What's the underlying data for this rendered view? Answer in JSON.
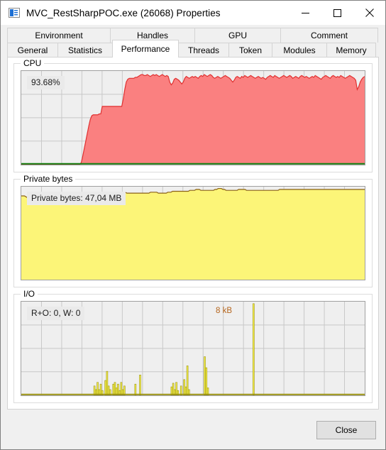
{
  "window": {
    "title": "MVC_RestSharpPOC.exe (26068) Properties",
    "icon": "properties-window-icon",
    "controls": {
      "minimize": "minimize-icon",
      "maximize": "maximize-icon",
      "close": "close-icon"
    }
  },
  "tabs": {
    "row1": [
      {
        "label": "Environment",
        "id": "environment",
        "selected": false
      },
      {
        "label": "Handles",
        "id": "handles",
        "selected": false
      },
      {
        "label": "GPU",
        "id": "gpu",
        "selected": false
      },
      {
        "label": "Comment",
        "id": "comment",
        "selected": false
      }
    ],
    "row2": [
      {
        "label": "General",
        "id": "general",
        "selected": false
      },
      {
        "label": "Statistics",
        "id": "statistics",
        "selected": false
      },
      {
        "label": "Performance",
        "id": "performance",
        "selected": true
      },
      {
        "label": "Threads",
        "id": "threads",
        "selected": false
      },
      {
        "label": "Token",
        "id": "token",
        "selected": false
      },
      {
        "label": "Modules",
        "id": "modules",
        "selected": false
      },
      {
        "label": "Memory",
        "id": "memory",
        "selected": false
      }
    ]
  },
  "panels": {
    "cpu": {
      "group_label": "CPU",
      "value_label": "93.68%"
    },
    "private_bytes": {
      "group_label": "Private bytes",
      "value_label": "Private bytes: 47,04 MB"
    },
    "io": {
      "group_label": "I/O",
      "value_label": "R+O: 0, W: 0",
      "peak_label": "8 kB"
    }
  },
  "footer": {
    "close_label": "Close"
  },
  "colors": {
    "cpu_fill": "#fa8080",
    "cpu_stroke": "#e03030",
    "cpu_baseline": "#128012",
    "private_fill": "#fcf578",
    "private_stroke": "#8a6118",
    "io_fill": "#f5ef4a",
    "io_stroke": "#9a9212",
    "io_peak_text": "#b5651d",
    "graph_bg": "#efefef",
    "grid": "#c8c8c8",
    "window_bg": "#f0f0f0"
  },
  "chart_data": [
    {
      "type": "area",
      "name": "cpu",
      "title": "CPU",
      "ylabel": "%",
      "ylim": [
        0,
        100
      ],
      "grid": true,
      "value_label": "93.68%",
      "current_value": 93.68,
      "values": [
        0,
        0,
        0,
        0,
        0,
        0,
        0,
        0,
        0,
        0,
        0,
        0,
        0,
        0,
        0,
        0,
        0,
        0,
        0,
        0,
        0,
        0,
        0,
        0,
        0,
        0,
        0,
        0,
        0,
        0,
        0,
        0,
        0,
        0,
        0,
        0,
        0,
        0,
        0,
        0,
        2,
        9,
        17,
        25,
        33,
        41,
        48,
        52,
        53,
        53,
        53,
        53,
        54,
        54,
        62,
        62,
        62,
        62,
        62,
        62,
        62,
        62,
        62,
        62,
        62,
        62,
        62,
        62,
        70,
        80,
        88,
        91,
        92,
        92,
        92,
        92,
        93,
        93,
        94,
        95,
        96,
        96,
        95,
        95,
        96,
        95,
        94,
        95,
        96,
        95,
        96,
        95,
        94,
        95,
        96,
        95,
        94,
        95,
        94,
        88,
        85,
        87,
        91,
        92,
        91,
        90,
        88,
        86,
        88,
        92,
        94,
        93,
        92,
        93,
        94,
        93,
        94,
        93,
        92,
        94,
        95,
        94,
        96,
        95,
        94,
        95,
        96,
        95,
        93,
        92,
        93,
        94,
        93,
        92,
        93,
        94,
        95,
        94,
        93,
        92,
        90,
        88,
        90,
        93,
        94,
        93,
        92,
        94,
        93,
        95,
        94,
        93,
        94,
        95,
        94,
        93,
        92,
        93,
        94,
        93,
        92,
        93,
        92,
        91,
        93,
        94,
        95,
        94,
        93,
        95,
        94,
        93,
        92,
        93,
        94,
        95,
        94,
        93,
        94,
        95,
        94,
        92,
        93,
        94,
        93,
        92,
        94,
        95,
        94,
        93,
        94,
        93,
        92,
        93,
        94,
        93,
        95,
        94,
        93,
        92,
        91,
        93,
        94,
        95,
        94,
        93,
        92,
        94,
        95,
        94,
        93,
        94,
        93,
        95,
        94,
        93,
        92,
        93,
        94,
        95,
        94,
        93,
        92,
        90,
        80,
        83,
        88,
        91,
        93,
        94
      ]
    },
    {
      "type": "area",
      "name": "private_bytes",
      "title": "Private bytes",
      "ylabel": "MB",
      "grid": true,
      "value_label": "Private bytes: 47,04 MB",
      "current_value": 47.04,
      "unit": "MB",
      "values": [
        91,
        91,
        91,
        90,
        89,
        89,
        90,
        91,
        91,
        90,
        89,
        89,
        90,
        91,
        91,
        91,
        91,
        90,
        89,
        89,
        90,
        91,
        91,
        91,
        91,
        91,
        91,
        91,
        91,
        91,
        91,
        90,
        89,
        89,
        90,
        91,
        91,
        91,
        91,
        91,
        91,
        91,
        92,
        93,
        94,
        94,
        94,
        94,
        94,
        94,
        94,
        94,
        93,
        92,
        92,
        93,
        94,
        94,
        94,
        95,
        95,
        95,
        95,
        95,
        95,
        95,
        95,
        94,
        94,
        94,
        94,
        94,
        94,
        94,
        94,
        94,
        94,
        94,
        94,
        94,
        94,
        94,
        95,
        95,
        95,
        95,
        95,
        94,
        94,
        94,
        94,
        94,
        94,
        95,
        95,
        95,
        96,
        96,
        96,
        96,
        96,
        96,
        96,
        96,
        96,
        96,
        96,
        97,
        97,
        97,
        97,
        98,
        98,
        98,
        97,
        97,
        97,
        97,
        97,
        97,
        97,
        97,
        97,
        98,
        98,
        99,
        99,
        99,
        98,
        98,
        97,
        97,
        97,
        97,
        97,
        97,
        97,
        97,
        98,
        98,
        98,
        98,
        98,
        97,
        97,
        97,
        97,
        97,
        97,
        97,
        97,
        97,
        97,
        97,
        97,
        97,
        97,
        97,
        97,
        97,
        97,
        97,
        97,
        97,
        98,
        98,
        98,
        98,
        98,
        98,
        98,
        98,
        98,
        98,
        98,
        98,
        98,
        98,
        98,
        98,
        98,
        98,
        98,
        98,
        98,
        98,
        98,
        98,
        98,
        98,
        98,
        98,
        98,
        98,
        98,
        98,
        98,
        98,
        98,
        98,
        98,
        98,
        98,
        98,
        98,
        98,
        98,
        98,
        98,
        98,
        98,
        98,
        98,
        98,
        98,
        98,
        98,
        98,
        98
      ]
    },
    {
      "type": "bar",
      "name": "io",
      "title": "I/O",
      "grid": true,
      "value_label": "R+O: 0, W: 0",
      "peak_label": "8 kB",
      "peak_index": 147,
      "values": [
        0,
        0,
        0,
        0,
        0,
        0,
        0,
        0,
        0,
        0,
        0,
        0,
        0,
        0,
        0,
        0,
        0,
        0,
        0,
        0,
        0,
        0,
        0,
        0,
        0,
        0,
        0,
        0,
        0,
        0,
        0,
        0,
        0,
        0,
        0,
        0,
        0,
        0,
        0,
        0,
        0,
        0,
        0,
        0,
        0,
        0,
        10,
        6,
        14,
        6,
        12,
        5,
        0,
        16,
        26,
        10,
        6,
        0,
        12,
        14,
        8,
        12,
        5,
        14,
        6,
        10,
        0,
        0,
        0,
        0,
        0,
        0,
        12,
        0,
        0,
        22,
        0,
        0,
        0,
        0,
        0,
        0,
        0,
        0,
        0,
        0,
        0,
        0,
        0,
        0,
        0,
        0,
        0,
        0,
        0,
        9,
        13,
        6,
        14,
        5,
        0,
        10,
        0,
        17,
        9,
        32,
        6,
        0,
        0,
        0,
        0,
        0,
        0,
        0,
        0,
        0,
        42,
        30,
        8,
        0,
        0,
        0,
        0,
        0,
        0,
        0,
        0,
        0,
        0,
        0,
        0,
        0,
        0,
        0,
        0,
        0,
        0,
        0,
        0,
        0,
        0,
        0,
        0,
        0,
        0,
        0,
        0,
        100,
        0,
        0,
        0,
        0,
        0,
        0,
        0,
        0,
        0,
        0,
        0,
        0,
        0,
        0,
        0,
        0,
        0,
        0,
        0,
        0,
        0,
        0,
        0,
        0,
        0,
        0,
        0,
        0,
        0,
        0,
        0,
        0,
        0,
        0,
        0,
        0,
        0,
        0,
        0,
        0,
        0,
        0,
        0,
        0,
        0,
        0,
        0,
        0,
        0,
        0,
        0,
        0,
        0,
        0,
        0,
        0,
        0,
        0,
        0,
        0,
        0,
        0,
        0,
        0,
        0,
        0,
        0,
        0,
        0,
        0
      ]
    }
  ]
}
